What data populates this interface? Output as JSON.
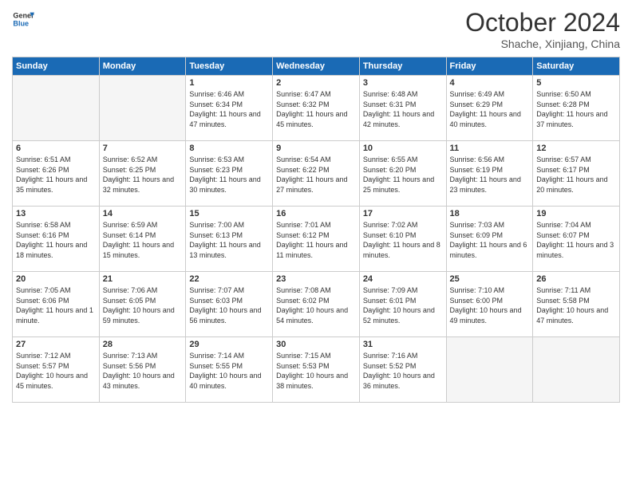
{
  "logo": {
    "line1": "General",
    "line2": "Blue"
  },
  "title": "October 2024",
  "subtitle": "Shache, Xinjiang, China",
  "headers": [
    "Sunday",
    "Monday",
    "Tuesday",
    "Wednesday",
    "Thursday",
    "Friday",
    "Saturday"
  ],
  "days": [
    {
      "num": "",
      "info": ""
    },
    {
      "num": "",
      "info": ""
    },
    {
      "num": "1",
      "info": "Sunrise: 6:46 AM\nSunset: 6:34 PM\nDaylight: 11 hours and 47 minutes."
    },
    {
      "num": "2",
      "info": "Sunrise: 6:47 AM\nSunset: 6:32 PM\nDaylight: 11 hours and 45 minutes."
    },
    {
      "num": "3",
      "info": "Sunrise: 6:48 AM\nSunset: 6:31 PM\nDaylight: 11 hours and 42 minutes."
    },
    {
      "num": "4",
      "info": "Sunrise: 6:49 AM\nSunset: 6:29 PM\nDaylight: 11 hours and 40 minutes."
    },
    {
      "num": "5",
      "info": "Sunrise: 6:50 AM\nSunset: 6:28 PM\nDaylight: 11 hours and 37 minutes."
    },
    {
      "num": "6",
      "info": "Sunrise: 6:51 AM\nSunset: 6:26 PM\nDaylight: 11 hours and 35 minutes."
    },
    {
      "num": "7",
      "info": "Sunrise: 6:52 AM\nSunset: 6:25 PM\nDaylight: 11 hours and 32 minutes."
    },
    {
      "num": "8",
      "info": "Sunrise: 6:53 AM\nSunset: 6:23 PM\nDaylight: 11 hours and 30 minutes."
    },
    {
      "num": "9",
      "info": "Sunrise: 6:54 AM\nSunset: 6:22 PM\nDaylight: 11 hours and 27 minutes."
    },
    {
      "num": "10",
      "info": "Sunrise: 6:55 AM\nSunset: 6:20 PM\nDaylight: 11 hours and 25 minutes."
    },
    {
      "num": "11",
      "info": "Sunrise: 6:56 AM\nSunset: 6:19 PM\nDaylight: 11 hours and 23 minutes."
    },
    {
      "num": "12",
      "info": "Sunrise: 6:57 AM\nSunset: 6:17 PM\nDaylight: 11 hours and 20 minutes."
    },
    {
      "num": "13",
      "info": "Sunrise: 6:58 AM\nSunset: 6:16 PM\nDaylight: 11 hours and 18 minutes."
    },
    {
      "num": "14",
      "info": "Sunrise: 6:59 AM\nSunset: 6:14 PM\nDaylight: 11 hours and 15 minutes."
    },
    {
      "num": "15",
      "info": "Sunrise: 7:00 AM\nSunset: 6:13 PM\nDaylight: 11 hours and 13 minutes."
    },
    {
      "num": "16",
      "info": "Sunrise: 7:01 AM\nSunset: 6:12 PM\nDaylight: 11 hours and 11 minutes."
    },
    {
      "num": "17",
      "info": "Sunrise: 7:02 AM\nSunset: 6:10 PM\nDaylight: 11 hours and 8 minutes."
    },
    {
      "num": "18",
      "info": "Sunrise: 7:03 AM\nSunset: 6:09 PM\nDaylight: 11 hours and 6 minutes."
    },
    {
      "num": "19",
      "info": "Sunrise: 7:04 AM\nSunset: 6:07 PM\nDaylight: 11 hours and 3 minutes."
    },
    {
      "num": "20",
      "info": "Sunrise: 7:05 AM\nSunset: 6:06 PM\nDaylight: 11 hours and 1 minute."
    },
    {
      "num": "21",
      "info": "Sunrise: 7:06 AM\nSunset: 6:05 PM\nDaylight: 10 hours and 59 minutes."
    },
    {
      "num": "22",
      "info": "Sunrise: 7:07 AM\nSunset: 6:03 PM\nDaylight: 10 hours and 56 minutes."
    },
    {
      "num": "23",
      "info": "Sunrise: 7:08 AM\nSunset: 6:02 PM\nDaylight: 10 hours and 54 minutes."
    },
    {
      "num": "24",
      "info": "Sunrise: 7:09 AM\nSunset: 6:01 PM\nDaylight: 10 hours and 52 minutes."
    },
    {
      "num": "25",
      "info": "Sunrise: 7:10 AM\nSunset: 6:00 PM\nDaylight: 10 hours and 49 minutes."
    },
    {
      "num": "26",
      "info": "Sunrise: 7:11 AM\nSunset: 5:58 PM\nDaylight: 10 hours and 47 minutes."
    },
    {
      "num": "27",
      "info": "Sunrise: 7:12 AM\nSunset: 5:57 PM\nDaylight: 10 hours and 45 minutes."
    },
    {
      "num": "28",
      "info": "Sunrise: 7:13 AM\nSunset: 5:56 PM\nDaylight: 10 hours and 43 minutes."
    },
    {
      "num": "29",
      "info": "Sunrise: 7:14 AM\nSunset: 5:55 PM\nDaylight: 10 hours and 40 minutes."
    },
    {
      "num": "30",
      "info": "Sunrise: 7:15 AM\nSunset: 5:53 PM\nDaylight: 10 hours and 38 minutes."
    },
    {
      "num": "31",
      "info": "Sunrise: 7:16 AM\nSunset: 5:52 PM\nDaylight: 10 hours and 36 minutes."
    },
    {
      "num": "",
      "info": ""
    },
    {
      "num": "",
      "info": ""
    },
    {
      "num": "",
      "info": ""
    }
  ]
}
